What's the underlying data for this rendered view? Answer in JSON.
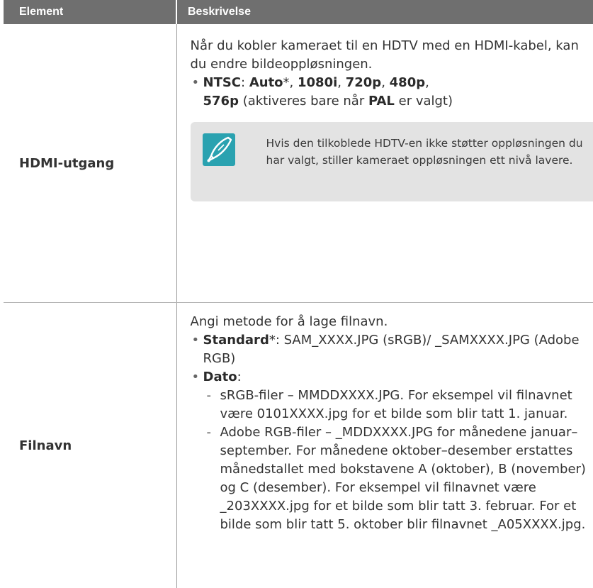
{
  "header": {
    "col_element": "Element",
    "col_description": "Beskrivelse",
    "corner_fragment": "..."
  },
  "rows": [
    {
      "element": "HDMI-utgang",
      "intro": "Når du kobler kameraet til en HDTV med en HDMI-kabel, kan du endre bildeoppløsningen.",
      "bullet": {
        "label": "NTSC",
        "sep": ": ",
        "v1": "Auto",
        "v1_suffix": "*, ",
        "v2": "1080i",
        "v3": "720p",
        "v4": "480p",
        "v5": "576p",
        "comma": ", ",
        "paren_pre": " (aktiveres bare når ",
        "pal": "PAL",
        "paren_post": " er valgt)"
      },
      "note": {
        "icon": "pen-note-icon",
        "text": "Hvis den tilkoblede HDTV-en ikke støtter oppløsningen du har valgt, stiller kameraet oppløsningen ett nivå lavere."
      }
    },
    {
      "element": "Filnavn",
      "intro": "Angi metode for å lage filnavn.",
      "standard": {
        "label": "Standard",
        "rest": "*: SAM_XXXX.JPG (sRGB)/ _SAMXXXX.JPG (Adobe RGB)"
      },
      "dato": {
        "label": "Dato",
        "colon": ":",
        "sub1": "sRGB-filer – MMDDXXXX.JPG. For eksempel vil filnavnet være 0101XXXX.jpg for et bilde som blir tatt 1. januar.",
        "sub2": "Adobe RGB-filer – _MDDXXXX.JPG for månedene januar–september. For månedene oktober–desember erstattes månedstallet med bokstavene A (oktober), B (november) og C (desember). For eksempel vil filnavnet være _203XXXX.jpg for et bilde som blir tatt 3. februar. For et bilde som blir tatt 5. oktober blir filnavnet _A05XXXX.jpg."
      }
    }
  ],
  "colors": {
    "header_bg": "#6f6f6f",
    "note_bg": "#e3e3e3",
    "icon_bg": "#2aa2b0"
  }
}
